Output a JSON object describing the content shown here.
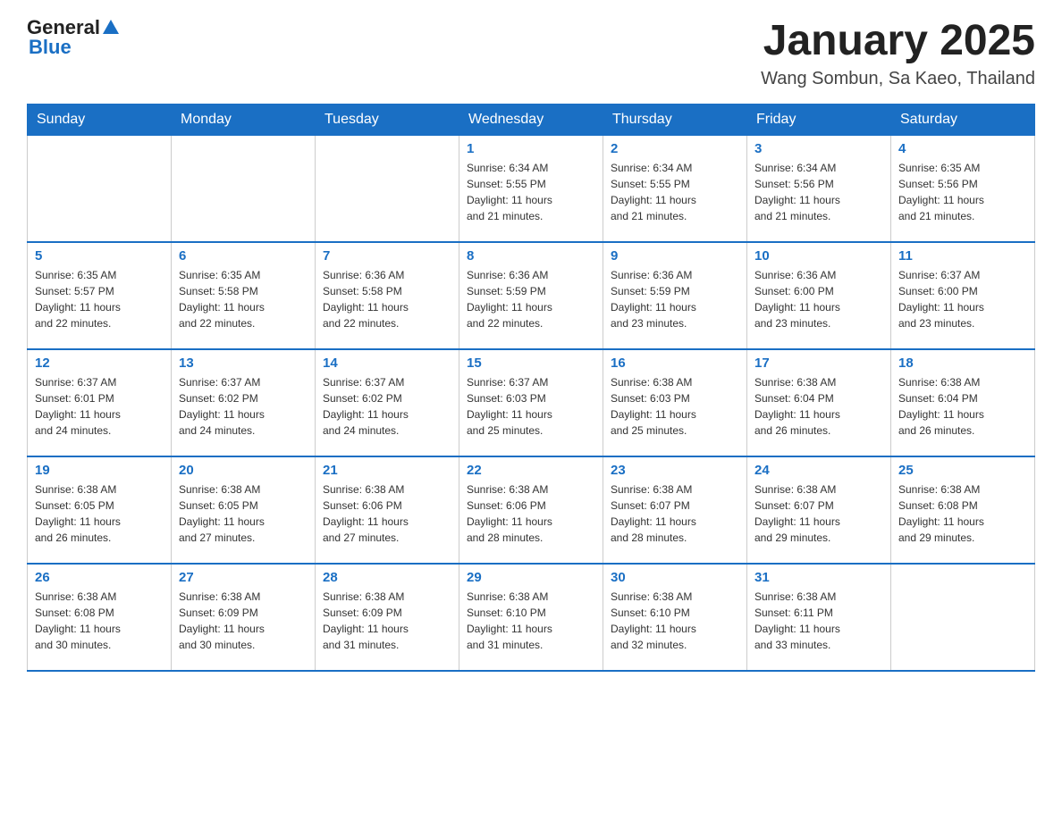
{
  "logo": {
    "general": "General",
    "blue": "Blue"
  },
  "title": "January 2025",
  "subtitle": "Wang Sombun, Sa Kaeo, Thailand",
  "days_of_week": [
    "Sunday",
    "Monday",
    "Tuesday",
    "Wednesday",
    "Thursday",
    "Friday",
    "Saturday"
  ],
  "weeks": [
    [
      {
        "day": "",
        "info": ""
      },
      {
        "day": "",
        "info": ""
      },
      {
        "day": "",
        "info": ""
      },
      {
        "day": "1",
        "info": "Sunrise: 6:34 AM\nSunset: 5:55 PM\nDaylight: 11 hours\nand 21 minutes."
      },
      {
        "day": "2",
        "info": "Sunrise: 6:34 AM\nSunset: 5:55 PM\nDaylight: 11 hours\nand 21 minutes."
      },
      {
        "day": "3",
        "info": "Sunrise: 6:34 AM\nSunset: 5:56 PM\nDaylight: 11 hours\nand 21 minutes."
      },
      {
        "day": "4",
        "info": "Sunrise: 6:35 AM\nSunset: 5:56 PM\nDaylight: 11 hours\nand 21 minutes."
      }
    ],
    [
      {
        "day": "5",
        "info": "Sunrise: 6:35 AM\nSunset: 5:57 PM\nDaylight: 11 hours\nand 22 minutes."
      },
      {
        "day": "6",
        "info": "Sunrise: 6:35 AM\nSunset: 5:58 PM\nDaylight: 11 hours\nand 22 minutes."
      },
      {
        "day": "7",
        "info": "Sunrise: 6:36 AM\nSunset: 5:58 PM\nDaylight: 11 hours\nand 22 minutes."
      },
      {
        "day": "8",
        "info": "Sunrise: 6:36 AM\nSunset: 5:59 PM\nDaylight: 11 hours\nand 22 minutes."
      },
      {
        "day": "9",
        "info": "Sunrise: 6:36 AM\nSunset: 5:59 PM\nDaylight: 11 hours\nand 23 minutes."
      },
      {
        "day": "10",
        "info": "Sunrise: 6:36 AM\nSunset: 6:00 PM\nDaylight: 11 hours\nand 23 minutes."
      },
      {
        "day": "11",
        "info": "Sunrise: 6:37 AM\nSunset: 6:00 PM\nDaylight: 11 hours\nand 23 minutes."
      }
    ],
    [
      {
        "day": "12",
        "info": "Sunrise: 6:37 AM\nSunset: 6:01 PM\nDaylight: 11 hours\nand 24 minutes."
      },
      {
        "day": "13",
        "info": "Sunrise: 6:37 AM\nSunset: 6:02 PM\nDaylight: 11 hours\nand 24 minutes."
      },
      {
        "day": "14",
        "info": "Sunrise: 6:37 AM\nSunset: 6:02 PM\nDaylight: 11 hours\nand 24 minutes."
      },
      {
        "day": "15",
        "info": "Sunrise: 6:37 AM\nSunset: 6:03 PM\nDaylight: 11 hours\nand 25 minutes."
      },
      {
        "day": "16",
        "info": "Sunrise: 6:38 AM\nSunset: 6:03 PM\nDaylight: 11 hours\nand 25 minutes."
      },
      {
        "day": "17",
        "info": "Sunrise: 6:38 AM\nSunset: 6:04 PM\nDaylight: 11 hours\nand 26 minutes."
      },
      {
        "day": "18",
        "info": "Sunrise: 6:38 AM\nSunset: 6:04 PM\nDaylight: 11 hours\nand 26 minutes."
      }
    ],
    [
      {
        "day": "19",
        "info": "Sunrise: 6:38 AM\nSunset: 6:05 PM\nDaylight: 11 hours\nand 26 minutes."
      },
      {
        "day": "20",
        "info": "Sunrise: 6:38 AM\nSunset: 6:05 PM\nDaylight: 11 hours\nand 27 minutes."
      },
      {
        "day": "21",
        "info": "Sunrise: 6:38 AM\nSunset: 6:06 PM\nDaylight: 11 hours\nand 27 minutes."
      },
      {
        "day": "22",
        "info": "Sunrise: 6:38 AM\nSunset: 6:06 PM\nDaylight: 11 hours\nand 28 minutes."
      },
      {
        "day": "23",
        "info": "Sunrise: 6:38 AM\nSunset: 6:07 PM\nDaylight: 11 hours\nand 28 minutes."
      },
      {
        "day": "24",
        "info": "Sunrise: 6:38 AM\nSunset: 6:07 PM\nDaylight: 11 hours\nand 29 minutes."
      },
      {
        "day": "25",
        "info": "Sunrise: 6:38 AM\nSunset: 6:08 PM\nDaylight: 11 hours\nand 29 minutes."
      }
    ],
    [
      {
        "day": "26",
        "info": "Sunrise: 6:38 AM\nSunset: 6:08 PM\nDaylight: 11 hours\nand 30 minutes."
      },
      {
        "day": "27",
        "info": "Sunrise: 6:38 AM\nSunset: 6:09 PM\nDaylight: 11 hours\nand 30 minutes."
      },
      {
        "day": "28",
        "info": "Sunrise: 6:38 AM\nSunset: 6:09 PM\nDaylight: 11 hours\nand 31 minutes."
      },
      {
        "day": "29",
        "info": "Sunrise: 6:38 AM\nSunset: 6:10 PM\nDaylight: 11 hours\nand 31 minutes."
      },
      {
        "day": "30",
        "info": "Sunrise: 6:38 AM\nSunset: 6:10 PM\nDaylight: 11 hours\nand 32 minutes."
      },
      {
        "day": "31",
        "info": "Sunrise: 6:38 AM\nSunset: 6:11 PM\nDaylight: 11 hours\nand 33 minutes."
      },
      {
        "day": "",
        "info": ""
      }
    ]
  ]
}
